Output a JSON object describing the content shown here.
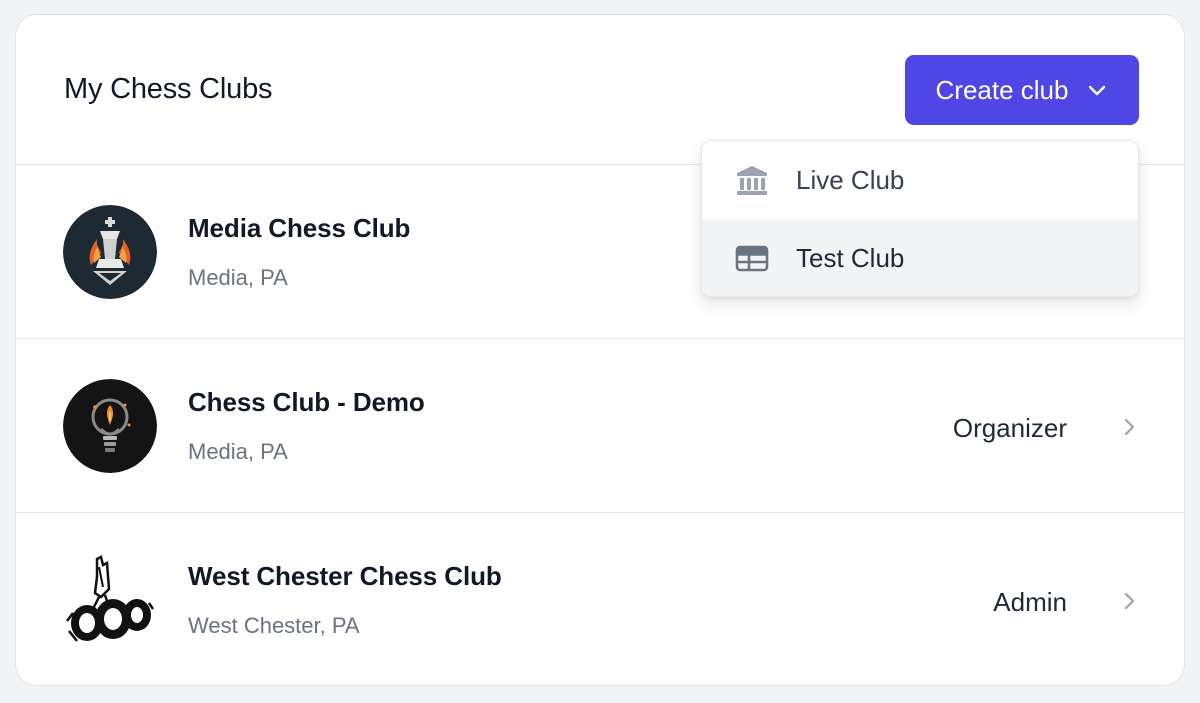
{
  "header": {
    "title": "My Chess Clubs",
    "create_button_label": "Create club"
  },
  "dropdown": {
    "items": [
      {
        "label": "Live Club",
        "icon": "building-library-icon",
        "highlighted": false
      },
      {
        "label": "Test Club",
        "icon": "table-icon",
        "highlighted": true
      }
    ]
  },
  "clubs": [
    {
      "name": "Media Chess Club",
      "location": "Media, PA",
      "role": "",
      "avatar": "flaming-king-logo"
    },
    {
      "name": "Chess Club - Demo",
      "location": "Media, PA",
      "role": "Organizer",
      "avatar": "lightbulb-logo"
    },
    {
      "name": "West Chester Chess Club",
      "location": "West Chester, PA",
      "role": "Admin",
      "avatar": "knight-sketch-logo"
    }
  ],
  "colors": {
    "accent": "#4f46e5",
    "background": "#f2f3f5",
    "card": "#ffffff",
    "muted_text": "#6b7280",
    "highlight_row": "#f3f4f6"
  }
}
